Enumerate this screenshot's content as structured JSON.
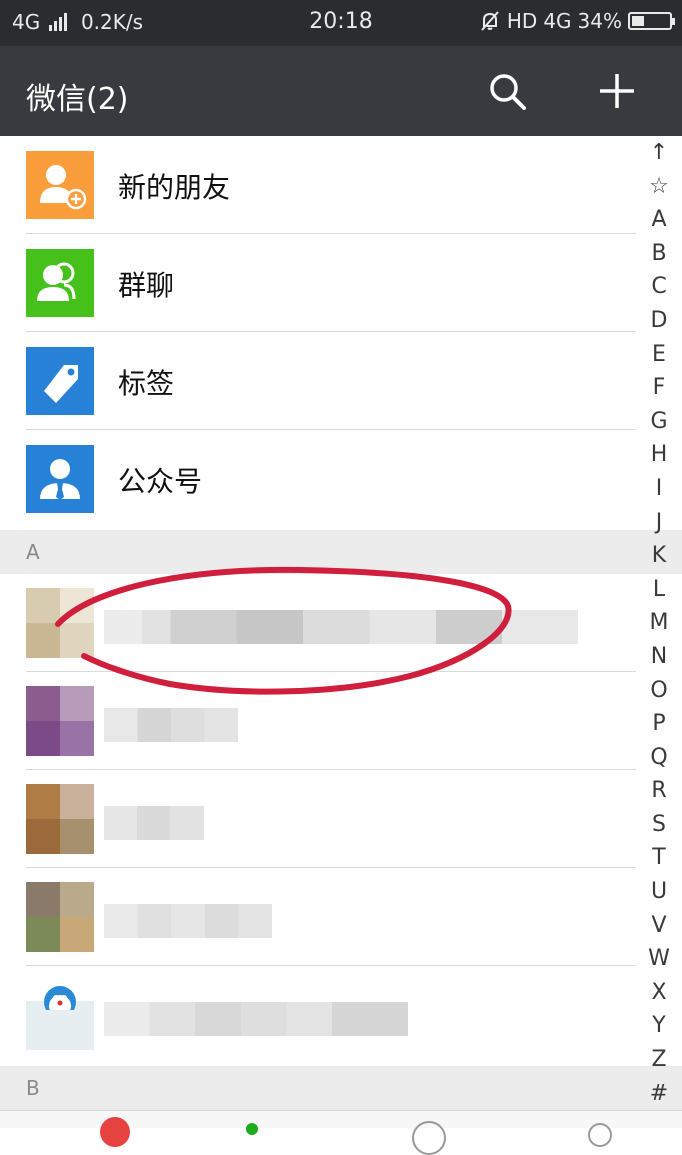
{
  "status_bar": {
    "network_type": "4G",
    "speed": "0.2K/s",
    "time": "20:18",
    "hd_label": "HD",
    "network_type_right": "4G",
    "battery": "34%",
    "battery_level": 0.34
  },
  "header": {
    "title": "微信(2)"
  },
  "menu_items": [
    {
      "label": "新的朋友",
      "icon": "add-friend-icon",
      "color": "#fa9d3b"
    },
    {
      "label": "群聊",
      "icon": "group-chat-icon",
      "color": "#46c11b"
    },
    {
      "label": "标签",
      "icon": "tag-icon",
      "color": "#2782d7"
    },
    {
      "label": "公众号",
      "icon": "official-account-icon",
      "color": "#2782d7"
    }
  ],
  "sections": {
    "a": "A",
    "b": "B"
  },
  "index_letters": [
    "↑",
    "☆",
    "A",
    "B",
    "C",
    "D",
    "E",
    "F",
    "G",
    "H",
    "I",
    "J",
    "K",
    "L",
    "M",
    "N",
    "O",
    "P",
    "Q",
    "R",
    "S",
    "T",
    "U",
    "V",
    "W",
    "X",
    "Y",
    "Z",
    "#"
  ],
  "colors": {
    "title_bar": "#393a3f",
    "status_bar": "#2b2c30",
    "annotation_circle": "#d01f3c"
  }
}
